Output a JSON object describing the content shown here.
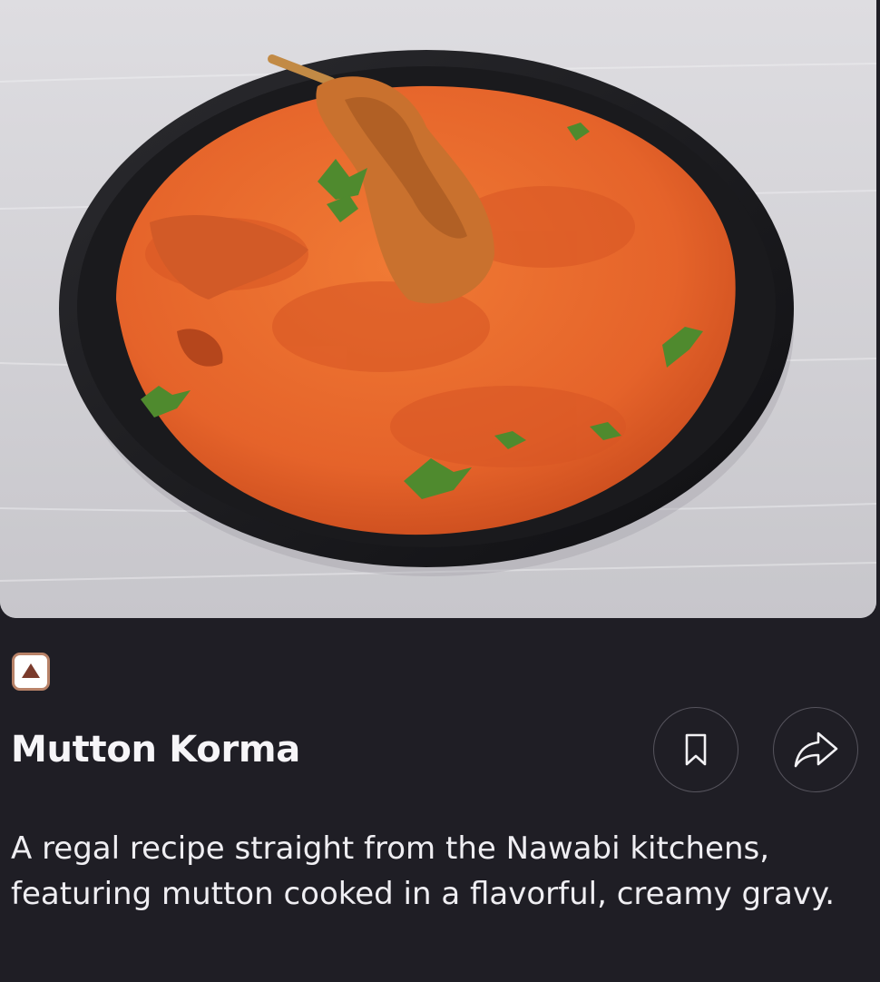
{
  "recipe": {
    "title": "Mutton Korma",
    "description": "A regal recipe straight from the Nawabi kitchens, featuring mutton cooked in a flavorful, creamy gravy.",
    "diet_badge_icon": "non-veg-triangle-icon",
    "image_alt": "Bowl of mutton korma"
  },
  "actions": {
    "bookmark_icon": "bookmark-icon",
    "share_icon": "share-icon"
  },
  "colors": {
    "background": "#1f1e25",
    "badge_border": "#b88268",
    "badge_triangle": "#7b3b2c",
    "curry": "#e8662a"
  }
}
